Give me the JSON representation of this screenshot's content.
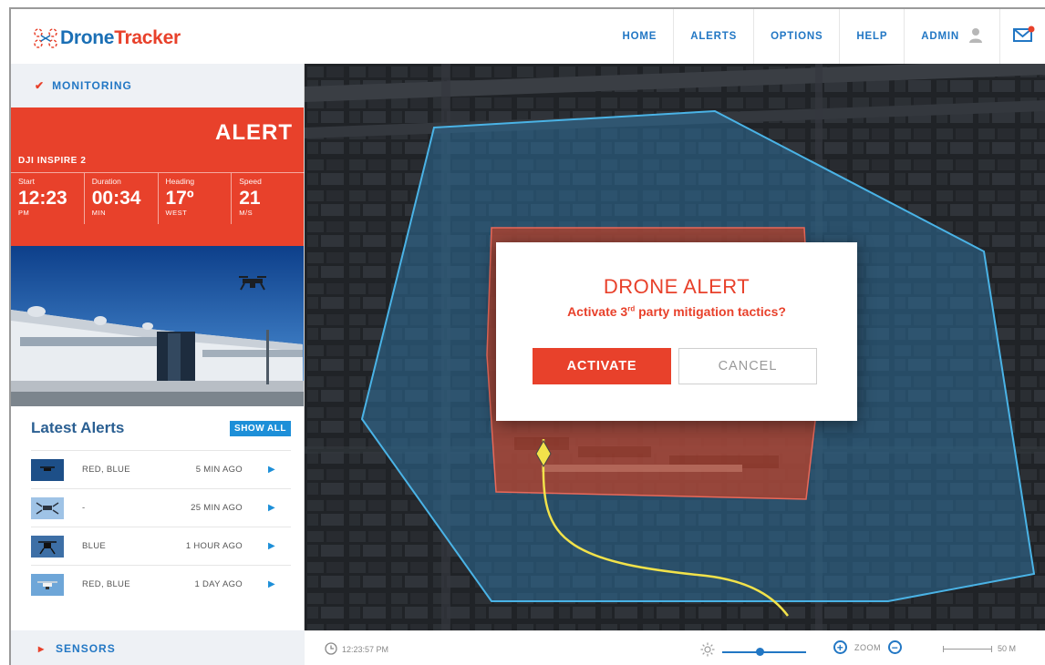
{
  "brand": {
    "name_part1": "Drone",
    "name_part2": "Tracker"
  },
  "nav": {
    "home": "HOME",
    "alerts": "ALERTS",
    "options": "OPTIONS",
    "help": "HELP",
    "admin": "ADMIN"
  },
  "sidebar": {
    "monitoring_label": "MONITORING",
    "alert": {
      "title": "ALERT",
      "drone": "DJI INSPIRE 2",
      "stats": [
        {
          "label": "Start",
          "value": "12:23",
          "unit": "PM"
        },
        {
          "label": "Duration",
          "value": "00:34",
          "unit": "MIN"
        },
        {
          "label": "Heading",
          "value": "17º",
          "unit": "WEST"
        },
        {
          "label": "Speed",
          "value": "21",
          "unit": "M/S"
        }
      ]
    },
    "latest_alerts": {
      "title": "Latest Alerts",
      "show_all": "SHOW ALL",
      "rows": [
        {
          "colors": "RED, BLUE",
          "time": "5 MIN AGO"
        },
        {
          "colors": "-",
          "time": "25 MIN AGO"
        },
        {
          "colors": "BLUE",
          "time": "1 HOUR AGO"
        },
        {
          "colors": "RED, BLUE",
          "time": "1 DAY AGO"
        }
      ]
    },
    "sensors_label": "SENSORS"
  },
  "modal": {
    "title": "DRONE ALERT",
    "message_pre": "Activate 3",
    "message_sup": "rd",
    "message_post": " party mitigation tactics?",
    "activate": "ACTIVATE",
    "cancel": "CANCEL"
  },
  "bottombar": {
    "timestamp": "12:23:57 PM",
    "brightness_level": 0.45,
    "zoom_label": "ZOOM",
    "scale_label": "50 M"
  },
  "colors": {
    "accent_red": "#e8412b",
    "accent_blue": "#2277c4",
    "zone_blue": "#3fa6dc",
    "flight_path": "#f2e24a"
  },
  "icons": {
    "logo": "drone-logo-icon",
    "user": "user-icon",
    "mail": "mail-icon",
    "clock": "clock-icon",
    "brightness": "brightness-icon",
    "zoom_in": "zoom-in-icon",
    "zoom_out": "zoom-out-icon",
    "chevron": "chevron-icon",
    "arrow": "arrow-right-icon"
  }
}
